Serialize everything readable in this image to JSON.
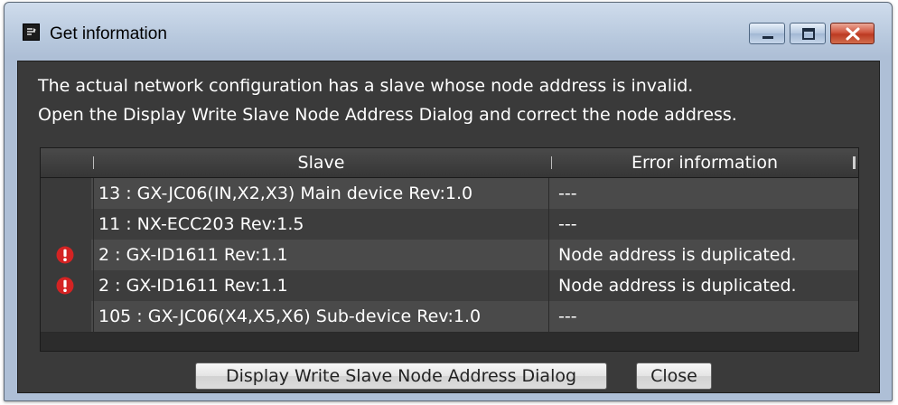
{
  "window": {
    "title": "Get information",
    "controls": {
      "minimize_icon": "minimize-icon",
      "maximize_icon": "maximize-icon",
      "close_icon": "close-icon"
    }
  },
  "message": {
    "line1": "The actual network configuration has a slave whose node address is invalid.",
    "line2": "Open the Display Write Slave Node Address Dialog and correct the node address."
  },
  "table": {
    "columns": [
      "Slave",
      "Error information"
    ],
    "rows": [
      {
        "icon": "",
        "slave": "13 : GX-JC06(IN,X2,X3) Main device Rev:1.0",
        "error": "---"
      },
      {
        "icon": "",
        "slave": "11 : NX-ECC203 Rev:1.5",
        "error": "---"
      },
      {
        "icon": "error-icon",
        "slave": "2 : GX-ID1611 Rev:1.1",
        "error": "Node address is duplicated."
      },
      {
        "icon": "error-icon",
        "slave": "2 : GX-ID1611 Rev:1.1",
        "error": "Node address is duplicated."
      },
      {
        "icon": "",
        "slave": "105 : GX-JC06(X4,X5,X6) Sub-device Rev:1.0",
        "error": "---"
      }
    ]
  },
  "buttons": {
    "display_dialog": "Display Write Slave Node Address Dialog",
    "close": "Close"
  },
  "colors": {
    "panel_bg": "#3a3a3a",
    "error_icon": "#d42323",
    "close_button": "#c9462e"
  }
}
